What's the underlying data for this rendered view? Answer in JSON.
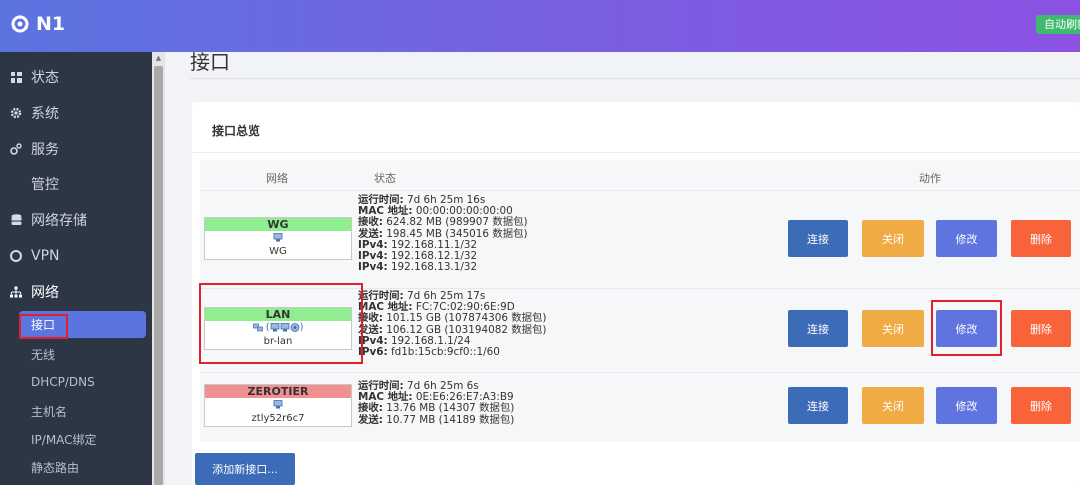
{
  "header": {
    "brand": "N1",
    "refresh_badge": "自动刷新"
  },
  "sidebar": {
    "items": [
      {
        "label": "状态",
        "icon": "dashboard-icon"
      },
      {
        "label": "系统",
        "icon": "gear-icon"
      },
      {
        "label": "服务",
        "icon": "cogs-icon"
      },
      {
        "label": "管控",
        "icon": ""
      },
      {
        "label": "网络存储",
        "icon": "database-icon"
      },
      {
        "label": "VPN",
        "icon": "vpn-icon"
      },
      {
        "label": "网络",
        "icon": "network-icon"
      }
    ],
    "submenu": [
      "接口",
      "无线",
      "DHCP/DNS",
      "主机名",
      "IP/MAC绑定",
      "静态路由"
    ]
  },
  "page": {
    "title": "接口",
    "card_title": "接口总览",
    "columns": {
      "network": "网络",
      "status": "状态",
      "actions": "动作"
    },
    "add_button": "添加新接口..."
  },
  "interfaces": [
    {
      "name": "WG",
      "color": "#90ee90",
      "device": "WG",
      "icons_text": "",
      "status": [
        {
          "k": "运行时间:",
          "v": " 7d 6h 25m 16s"
        },
        {
          "k": "MAC 地址:",
          "v": " 00:00:00:00:00:00"
        },
        {
          "k": "接收:",
          "v": " 624.82 MB (989907 数据包)"
        },
        {
          "k": "发送:",
          "v": " 198.45 MB (345016 数据包)"
        },
        {
          "k": "IPv4:",
          "v": " 192.168.11.1/32"
        },
        {
          "k": "IPv4:",
          "v": " 192.168.12.1/32"
        },
        {
          "k": "IPv4:",
          "v": " 192.168.13.1/32"
        }
      ]
    },
    {
      "name": "LAN",
      "color": "#90ee90",
      "device": "br-lan",
      "icons_text": "(",
      "status": [
        {
          "k": "运行时间:",
          "v": " 7d 6h 25m 17s"
        },
        {
          "k": "MAC 地址:",
          "v": " FC:7C:02:90:6E:9D"
        },
        {
          "k": "接收:",
          "v": " 101.15 GB (107874306 数据包)"
        },
        {
          "k": "发送:",
          "v": " 106.12 GB (103194082 数据包)"
        },
        {
          "k": "IPv4:",
          "v": " 192.168.1.1/24"
        },
        {
          "k": "IPv6:",
          "v": " fd1b:15cb:9cf0::1/60"
        }
      ]
    },
    {
      "name": "ZEROTIER",
      "color": "#f09090",
      "device": "ztly52r6c7",
      "icons_text": "",
      "status": [
        {
          "k": "运行时间:",
          "v": " 7d 6h 25m 6s"
        },
        {
          "k": "MAC 地址:",
          "v": " 0E:E6:26:E7:A3:B9"
        },
        {
          "k": "接收:",
          "v": " 13.76 MB (14307 数据包)"
        },
        {
          "k": "发送:",
          "v": " 10.77 MB (14189 数据包)"
        }
      ]
    }
  ],
  "actions": {
    "connect": "连接",
    "close": "关闭",
    "edit": "修改",
    "delete": "删除"
  }
}
